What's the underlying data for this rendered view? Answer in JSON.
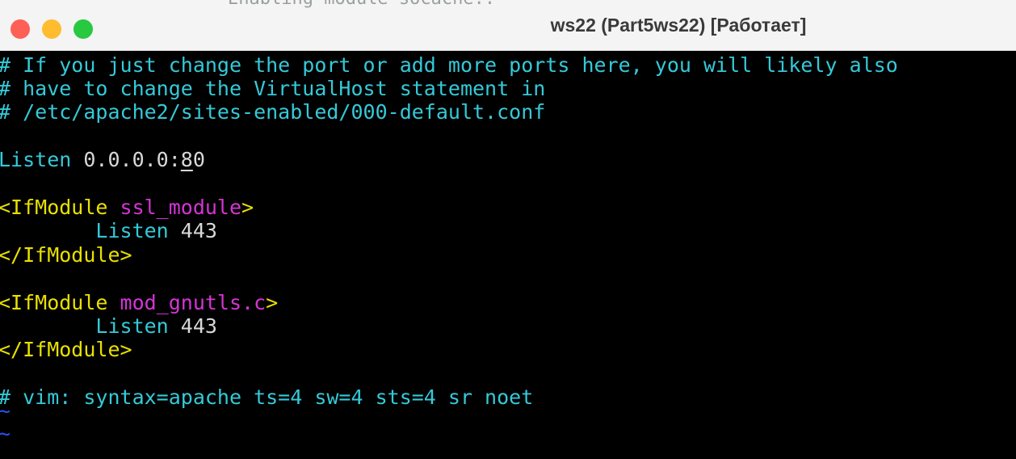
{
  "window": {
    "title": "ws22 (Part5ws22) [Работает]",
    "bleed_text": "Enabling module socache.."
  },
  "colors": {
    "background": "#000000",
    "comment": "#35c9d8",
    "keyword": "#35c9d8",
    "tag": "#e8e000",
    "module": "#d435d4",
    "value": "#d8d8d8",
    "tilde": "#2a52ff",
    "close": "#fe5f57",
    "minimize": "#febc2e",
    "maximize": "#28c840"
  },
  "terminal": {
    "lines": [
      {
        "segments": [
          {
            "text": "# If you just change the port or add more ports here, you will likely also",
            "color": "comment"
          }
        ]
      },
      {
        "segments": [
          {
            "text": "# have to change the VirtualHost statement in",
            "color": "comment"
          }
        ]
      },
      {
        "segments": [
          {
            "text": "# /etc/apache2/sites-enabled/000-default.conf",
            "color": "comment"
          }
        ]
      },
      {
        "segments": []
      },
      {
        "segments": [
          {
            "text": "Listen ",
            "color": "keyword"
          },
          {
            "text": "0.0.0.0:",
            "color": "value"
          },
          {
            "text": "8",
            "color": "value",
            "cursor": true
          },
          {
            "text": "0",
            "color": "value"
          }
        ]
      },
      {
        "segments": []
      },
      {
        "segments": [
          {
            "text": "<IfModule ",
            "color": "tag"
          },
          {
            "text": "ssl_module",
            "color": "module"
          },
          {
            "text": ">",
            "color": "tag"
          }
        ]
      },
      {
        "segments": [
          {
            "text": "        Listen ",
            "color": "keyword"
          },
          {
            "text": "443",
            "color": "value"
          }
        ]
      },
      {
        "segments": [
          {
            "text": "</IfModule>",
            "color": "tag"
          }
        ]
      },
      {
        "segments": []
      },
      {
        "segments": [
          {
            "text": "<IfModule ",
            "color": "tag"
          },
          {
            "text": "mod_gnutls.c",
            "color": "module"
          },
          {
            "text": ">",
            "color": "tag"
          }
        ]
      },
      {
        "segments": [
          {
            "text": "        Listen ",
            "color": "keyword"
          },
          {
            "text": "443",
            "color": "value"
          }
        ]
      },
      {
        "segments": [
          {
            "text": "</IfModule>",
            "color": "tag"
          }
        ]
      },
      {
        "segments": []
      },
      {
        "segments": [
          {
            "text": "# vim: syntax=apache ts=4 sw=4 sts=4 sr noet",
            "color": "comment"
          }
        ]
      },
      {
        "segments": [
          {
            "text": "~",
            "color": "tilde"
          }
        ]
      },
      {
        "segments": [
          {
            "text": "~",
            "color": "tilde"
          }
        ]
      }
    ]
  }
}
